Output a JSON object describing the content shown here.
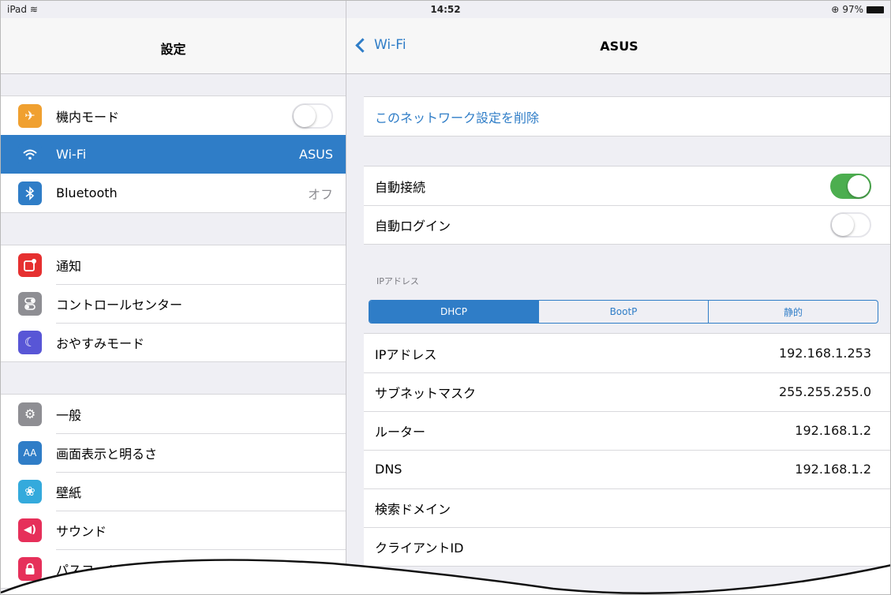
{
  "status_bar": {
    "device": "iPad",
    "time": "14:52",
    "battery": "97%"
  },
  "master": {
    "title": "設定",
    "groups": [
      [
        {
          "label": "機内モード",
          "icon": "airplane-icon",
          "color": "#f0a030",
          "toggle": false
        },
        {
          "label": "Wi-Fi",
          "icon": "wifi-icon",
          "color": "#2f7dc7",
          "value": "ASUS",
          "selected": true
        },
        {
          "label": "Bluetooth",
          "icon": "bluetooth-icon",
          "color": "#2f7dc7",
          "value": "オフ"
        }
      ],
      [
        {
          "label": "通知",
          "icon": "notifications-icon",
          "color": "#e63030"
        },
        {
          "label": "コントロールセンター",
          "icon": "control-center-icon",
          "color": "#8e8e93"
        },
        {
          "label": "おやすみモード",
          "icon": "moon-icon",
          "color": "#5856d6"
        }
      ],
      [
        {
          "label": "一般",
          "icon": "gear-icon",
          "color": "#8e8e93"
        },
        {
          "label": "画面表示と明るさ",
          "icon": "display-brightness-icon",
          "color": "#2f7dc7"
        },
        {
          "label": "壁紙",
          "icon": "wallpaper-icon",
          "color": "#34aadc"
        },
        {
          "label": "サウンド",
          "icon": "sound-icon",
          "color": "#e6305a"
        },
        {
          "label": "パスコード",
          "icon": "lock-icon",
          "color": "#e6305a"
        }
      ]
    ]
  },
  "detail": {
    "back_label": "Wi-Fi",
    "title": "ASUS",
    "forget_label": "このネットワーク設定を削除",
    "auto_join_label": "自動接続",
    "auto_join": true,
    "auto_login_label": "自動ログイン",
    "auto_login": false,
    "ip_section_label": "IPアドレス",
    "segments": [
      "DHCP",
      "BootP",
      "静的"
    ],
    "selected_segment": "DHCP",
    "ip_rows": [
      {
        "label": "IPアドレス",
        "value": "192.168.1.253"
      },
      {
        "label": "サブネットマスク",
        "value": "255.255.255.0"
      },
      {
        "label": "ルーター",
        "value": "192.168.1.2"
      },
      {
        "label": "DNS",
        "value": "192.168.1.2"
      },
      {
        "label": "検索ドメイン",
        "value": ""
      },
      {
        "label": "クライアントID",
        "value": ""
      }
    ]
  }
}
